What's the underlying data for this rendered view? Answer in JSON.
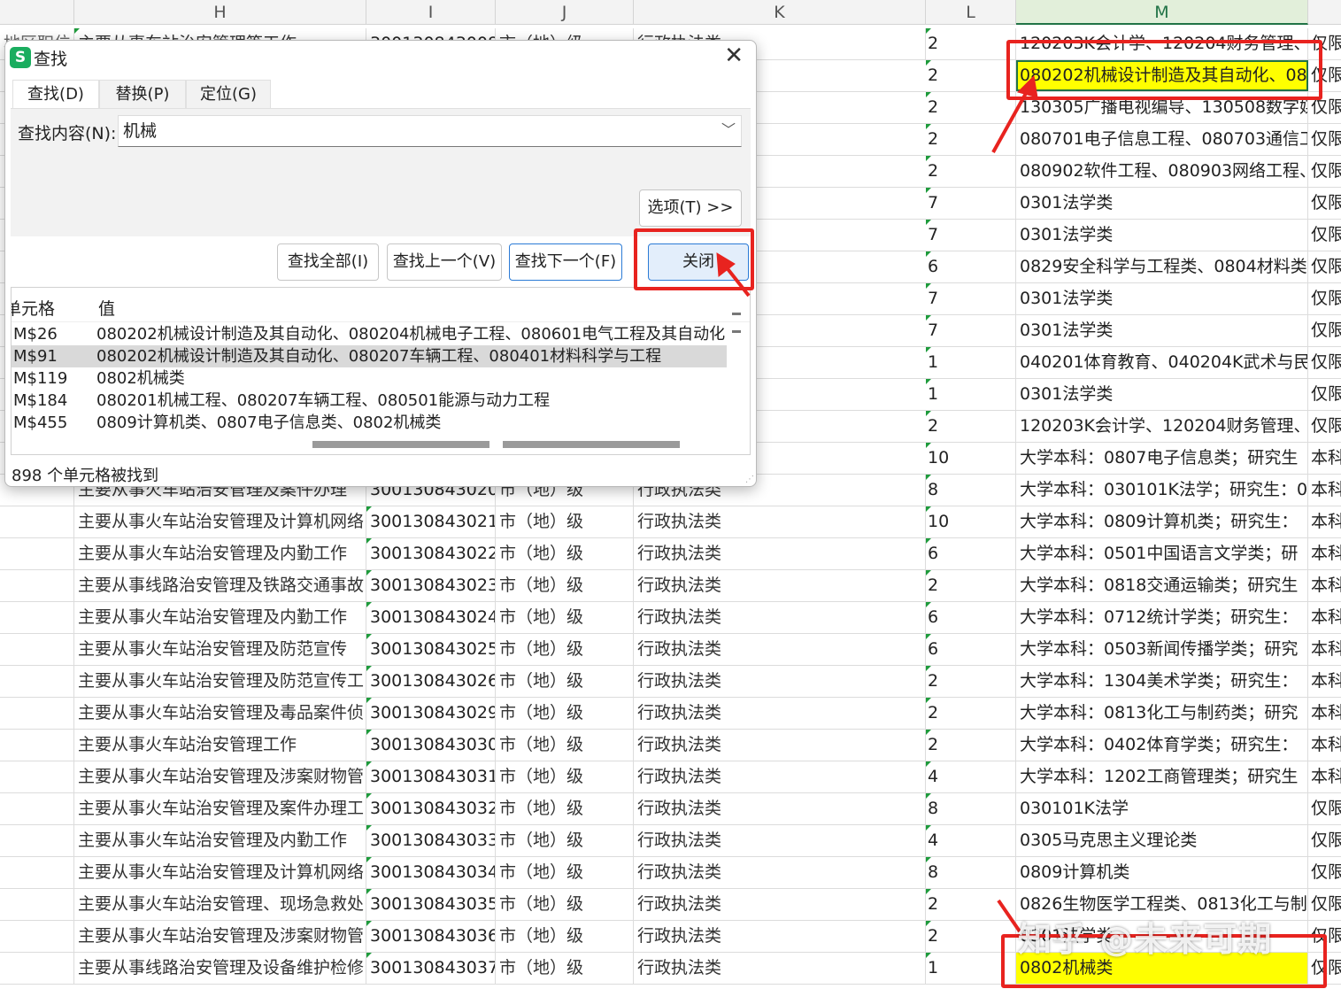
{
  "columns": [
    "H",
    "I",
    "J",
    "K",
    "L",
    "M"
  ],
  "active_column": "M",
  "top_rows": [
    {
      "h": "地区职位",
      "ha": "主要从事车站治安管理等工作",
      "i": "300130843008",
      "j": "市（地）级",
      "k": "行政执法类",
      "l": "2",
      "m": "120203K会计学、120204财务管理、",
      "n": "仅限"
    },
    {
      "l": "2",
      "m": "080202机械设计制造及其自动化、08",
      "n": "仅限"
    },
    {
      "l": "2",
      "m": "130305广播电视编导、130508数字媒",
      "n": "仅限"
    },
    {
      "l": "2",
      "m": "080701电子信息工程、080703通信工",
      "n": "仅限"
    },
    {
      "l": "2",
      "m": "080902软件工程、080903网络工程、",
      "n": "仅限"
    },
    {
      "l": "7",
      "m": "0301法学类",
      "n": "仅限"
    },
    {
      "l": "7",
      "m": "0301法学类",
      "n": "仅限"
    },
    {
      "l": "6",
      "m": "0829安全科学与工程类、0804材料类",
      "n": "仅限"
    },
    {
      "l": "7",
      "m": "0301法学类",
      "n": "仅限"
    },
    {
      "l": "7",
      "m": "0301法学类",
      "n": "仅限"
    },
    {
      "l": "1",
      "m": "040201体育教育、040204K武术与民",
      "n": "仅限"
    },
    {
      "l": "1",
      "m": "0301法学类",
      "n": "仅限"
    },
    {
      "l": "2",
      "m": "120203K会计学、120204财务管理、",
      "n": "仅限"
    },
    {
      "l": "10",
      "m": "大学本科：0807电子信息类；研究生",
      "n": "本科"
    }
  ],
  "rows": [
    {
      "h": "主要从事火车站治安管理及案件办理",
      "i": "300130843020",
      "j": "市（地）级",
      "k": "行政执法类",
      "l": "8",
      "m": "大学本科：030101K法学；研究生：0",
      "n": "本科"
    },
    {
      "h": "主要从事火车站治安管理及计算机网络",
      "i": "300130843021",
      "j": "市（地）级",
      "k": "行政执法类",
      "l": "10",
      "m": "大学本科：0809计算机类；研究生：",
      "n": "本科"
    },
    {
      "h": "主要从事火车站治安管理及内勤工作",
      "i": "300130843022",
      "j": "市（地）级",
      "k": "行政执法类",
      "l": "6",
      "m": "大学本科：0501中国语言文学类；研",
      "n": "本科"
    },
    {
      "h": "主要从事线路治安管理及铁路交通事故",
      "i": "300130843023",
      "j": "市（地）级",
      "k": "行政执法类",
      "l": "2",
      "m": "大学本科：0818交通运输类；研究生",
      "n": "本科"
    },
    {
      "h": "主要从事火车站治安管理及内勤工作",
      "i": "300130843024",
      "j": "市（地）级",
      "k": "行政执法类",
      "l": "6",
      "m": "大学本科：0712统计学类；研究生：",
      "n": "本科"
    },
    {
      "h": "主要从事火车站治安管理及防范宣传",
      "i": "300130843025",
      "j": "市（地）级",
      "k": "行政执法类",
      "l": "6",
      "m": "大学本科：0503新闻传播学类；研究",
      "n": "本科"
    },
    {
      "h": "主要从事火车站治安管理及防范宣传工",
      "i": "300130843026",
      "j": "市（地）级",
      "k": "行政执法类",
      "l": "2",
      "m": "大学本科：1304美术学类；研究生：",
      "n": "本科"
    },
    {
      "h": "主要从事火车站治安管理及毒品案件侦",
      "i": "300130843029",
      "j": "市（地）级",
      "k": "行政执法类",
      "l": "2",
      "m": "大学本科：0813化工与制药类；研究",
      "n": "本科"
    },
    {
      "h": "主要从事火车站治安管理工作",
      "i": "300130843030",
      "j": "市（地）级",
      "k": "行政执法类",
      "l": "2",
      "m": "大学本科：0402体育学类；研究生：",
      "n": "本科"
    },
    {
      "h": "主要从事火车站治安管理及涉案财物管",
      "i": "300130843031",
      "j": "市（地）级",
      "k": "行政执法类",
      "l": "4",
      "m": "大学本科：1202工商管理类；研究生",
      "n": "本科"
    },
    {
      "h": "主要从事火车站治安管理及案件办理工",
      "i": "300130843032",
      "j": "市（地）级",
      "k": "行政执法类",
      "l": "8",
      "m": "030101K法学",
      "n": "仅限"
    },
    {
      "h": "主要从事火车站治安管理及内勤工作",
      "i": "300130843033",
      "j": "市（地）级",
      "k": "行政执法类",
      "l": "4",
      "m": "0305马克思主义理论类",
      "n": "仅限"
    },
    {
      "h": "主要从事火车站治安管理及计算机网络",
      "i": "300130843034",
      "j": "市（地）级",
      "k": "行政执法类",
      "l": "8",
      "m": "0809计算机类",
      "n": "仅限"
    },
    {
      "h": "主要从事火车站治安管理、现场急救处",
      "i": "300130843035",
      "j": "市（地）级",
      "k": "行政执法类",
      "l": "2",
      "m": "0826生物医学工程类、0813化工与制",
      "n": "仅限"
    },
    {
      "h": "主要从事火车站治安管理及涉案财物管",
      "i": "300130843036",
      "j": "市（地）级",
      "k": "行政执法类",
      "l": "2",
      "m": "0301法学类",
      "n": "仅限"
    },
    {
      "h": "主要从事线路治安管理及设备维护检修",
      "i": "300130843037",
      "j": "市（地）级",
      "k": "行政执法类",
      "l": "1",
      "m": "0802机械类",
      "n": "仅限"
    }
  ],
  "dialog": {
    "title": "查找",
    "app_icon": "S",
    "tabs": [
      "查找(D)",
      "替换(P)",
      "定位(G)"
    ],
    "find_label": "查找内容(N):",
    "find_value": "机械",
    "options_button": "选项(T) >>",
    "find_all": "查找全部(I)",
    "find_prev": "查找上一个(V)",
    "find_next": "查找下一个(F)",
    "close_button": "关闭",
    "results_header": [
      "单元格",
      "值"
    ],
    "results": [
      {
        "cell": "M$26",
        "value": "080202机械设计制造及其自动化、080204机械电子工程、080601电气工程及其自动化"
      },
      {
        "cell": "M$91",
        "value": "080202机械设计制造及其自动化、080207车辆工程、080401材料科学与工程"
      },
      {
        "cell": "M$119",
        "value": "0802机械类"
      },
      {
        "cell": "M$184",
        "value": "080201机械工程、080207车辆工程、080501能源与动力工程"
      },
      {
        "cell": "M$455",
        "value": "0809计算机类、0807电子信息类、0802机械类"
      }
    ],
    "selected_result": 1,
    "status": "898 个单元格被找到"
  },
  "watermark": "知乎 @未来可期",
  "colors": {
    "highlight": "#ffff00",
    "annotation": "#e8231f",
    "accent": "#217346"
  }
}
